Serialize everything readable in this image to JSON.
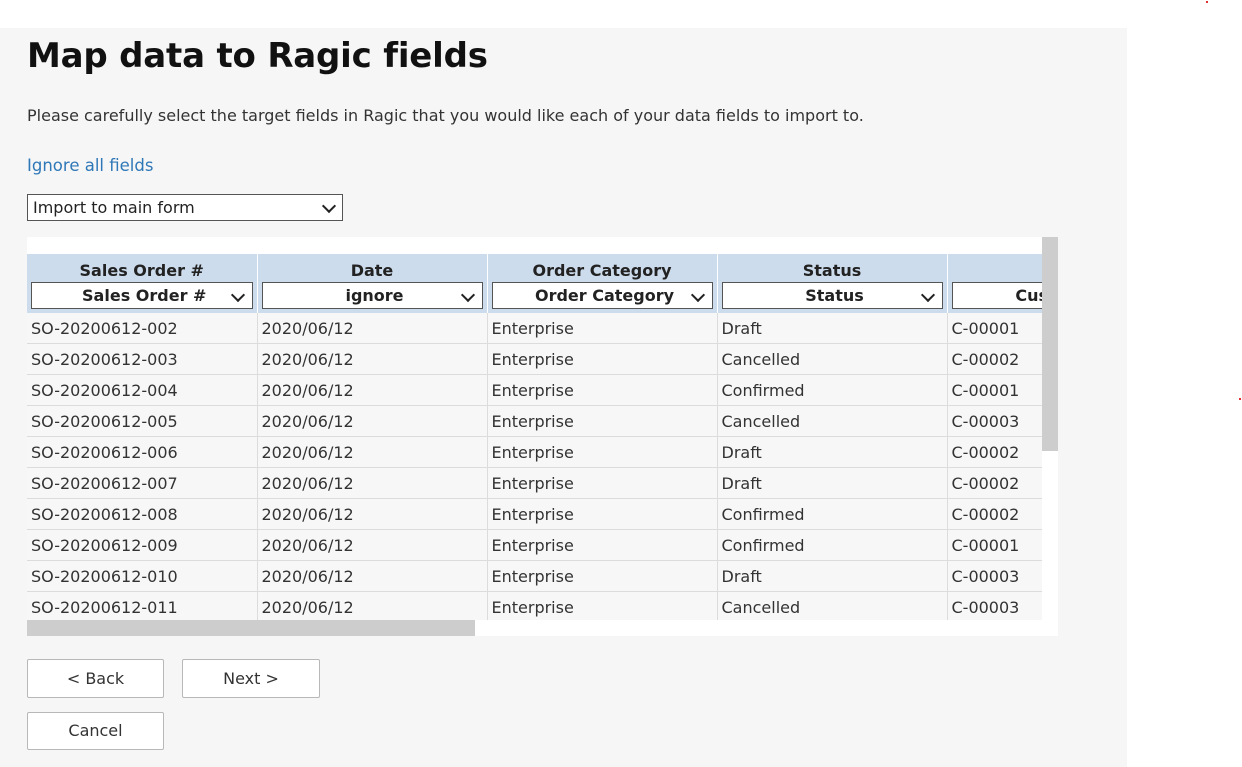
{
  "page": {
    "title": "Map data to Ragic fields",
    "description": "Please carefully select the target fields in Ragic that you would like each of your data fields to import to.",
    "ignore_all_link": "Ignore all fields",
    "import_target": "Import to main form"
  },
  "grid": {
    "columns": [
      {
        "header": "Sales Order #",
        "mapping": "Sales Order #"
      },
      {
        "header": "Date",
        "mapping": "ignore"
      },
      {
        "header": "Order Category",
        "mapping": "Order Category"
      },
      {
        "header": "Status",
        "mapping": "Status"
      },
      {
        "header": "Cust",
        "mapping": "Customer I"
      }
    ],
    "rows": [
      [
        "SO-20200612-002",
        "2020/06/12",
        "Enterprise",
        "Draft",
        "C-00001"
      ],
      [
        "SO-20200612-003",
        "2020/06/12",
        "Enterprise",
        "Cancelled",
        "C-00002"
      ],
      [
        "SO-20200612-004",
        "2020/06/12",
        "Enterprise",
        "Confirmed",
        "C-00001"
      ],
      [
        "SO-20200612-005",
        "2020/06/12",
        "Enterprise",
        "Cancelled",
        "C-00003"
      ],
      [
        "SO-20200612-006",
        "2020/06/12",
        "Enterprise",
        "Draft",
        "C-00002"
      ],
      [
        "SO-20200612-007",
        "2020/06/12",
        "Enterprise",
        "Draft",
        "C-00002"
      ],
      [
        "SO-20200612-008",
        "2020/06/12",
        "Enterprise",
        "Confirmed",
        "C-00002"
      ],
      [
        "SO-20200612-009",
        "2020/06/12",
        "Enterprise",
        "Confirmed",
        "C-00001"
      ],
      [
        "SO-20200612-010",
        "2020/06/12",
        "Enterprise",
        "Draft",
        "C-00003"
      ],
      [
        "SO-20200612-011",
        "2020/06/12",
        "Enterprise",
        "Cancelled",
        "C-00003"
      ]
    ]
  },
  "buttons": {
    "back": "< Back",
    "next": "Next >",
    "cancel": "Cancel"
  },
  "colors": {
    "link": "#2f78b8",
    "header_bg": "#cddcec",
    "panel_bg": "#f6f6f6"
  },
  "icons": {
    "dropdown": "chevron-down-icon"
  }
}
